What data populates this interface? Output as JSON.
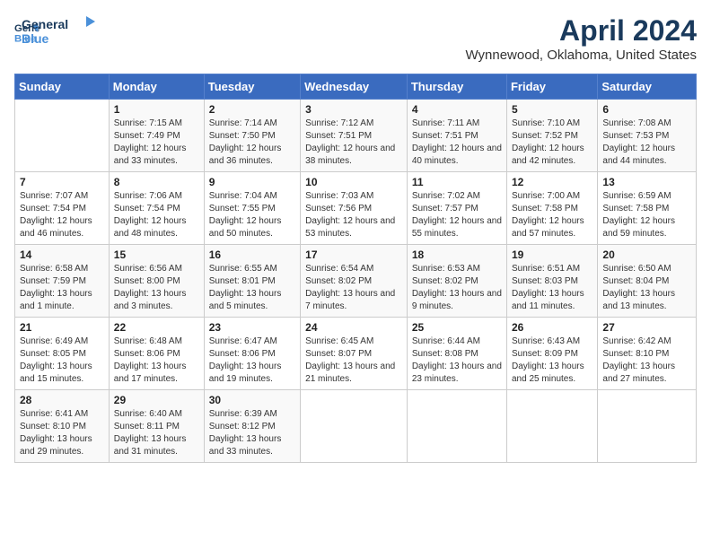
{
  "logo": {
    "line1": "General",
    "line2": "Blue"
  },
  "title": "April 2024",
  "subtitle": "Wynnewood, Oklahoma, United States",
  "days_of_week": [
    "Sunday",
    "Monday",
    "Tuesday",
    "Wednesday",
    "Thursday",
    "Friday",
    "Saturday"
  ],
  "weeks": [
    [
      {
        "day": "",
        "sunrise": "",
        "sunset": "",
        "daylight": ""
      },
      {
        "day": "1",
        "sunrise": "Sunrise: 7:15 AM",
        "sunset": "Sunset: 7:49 PM",
        "daylight": "Daylight: 12 hours and 33 minutes."
      },
      {
        "day": "2",
        "sunrise": "Sunrise: 7:14 AM",
        "sunset": "Sunset: 7:50 PM",
        "daylight": "Daylight: 12 hours and 36 minutes."
      },
      {
        "day": "3",
        "sunrise": "Sunrise: 7:12 AM",
        "sunset": "Sunset: 7:51 PM",
        "daylight": "Daylight: 12 hours and 38 minutes."
      },
      {
        "day": "4",
        "sunrise": "Sunrise: 7:11 AM",
        "sunset": "Sunset: 7:51 PM",
        "daylight": "Daylight: 12 hours and 40 minutes."
      },
      {
        "day": "5",
        "sunrise": "Sunrise: 7:10 AM",
        "sunset": "Sunset: 7:52 PM",
        "daylight": "Daylight: 12 hours and 42 minutes."
      },
      {
        "day": "6",
        "sunrise": "Sunrise: 7:08 AM",
        "sunset": "Sunset: 7:53 PM",
        "daylight": "Daylight: 12 hours and 44 minutes."
      }
    ],
    [
      {
        "day": "7",
        "sunrise": "Sunrise: 7:07 AM",
        "sunset": "Sunset: 7:54 PM",
        "daylight": "Daylight: 12 hours and 46 minutes."
      },
      {
        "day": "8",
        "sunrise": "Sunrise: 7:06 AM",
        "sunset": "Sunset: 7:54 PM",
        "daylight": "Daylight: 12 hours and 48 minutes."
      },
      {
        "day": "9",
        "sunrise": "Sunrise: 7:04 AM",
        "sunset": "Sunset: 7:55 PM",
        "daylight": "Daylight: 12 hours and 50 minutes."
      },
      {
        "day": "10",
        "sunrise": "Sunrise: 7:03 AM",
        "sunset": "Sunset: 7:56 PM",
        "daylight": "Daylight: 12 hours and 53 minutes."
      },
      {
        "day": "11",
        "sunrise": "Sunrise: 7:02 AM",
        "sunset": "Sunset: 7:57 PM",
        "daylight": "Daylight: 12 hours and 55 minutes."
      },
      {
        "day": "12",
        "sunrise": "Sunrise: 7:00 AM",
        "sunset": "Sunset: 7:58 PM",
        "daylight": "Daylight: 12 hours and 57 minutes."
      },
      {
        "day": "13",
        "sunrise": "Sunrise: 6:59 AM",
        "sunset": "Sunset: 7:58 PM",
        "daylight": "Daylight: 12 hours and 59 minutes."
      }
    ],
    [
      {
        "day": "14",
        "sunrise": "Sunrise: 6:58 AM",
        "sunset": "Sunset: 7:59 PM",
        "daylight": "Daylight: 13 hours and 1 minute."
      },
      {
        "day": "15",
        "sunrise": "Sunrise: 6:56 AM",
        "sunset": "Sunset: 8:00 PM",
        "daylight": "Daylight: 13 hours and 3 minutes."
      },
      {
        "day": "16",
        "sunrise": "Sunrise: 6:55 AM",
        "sunset": "Sunset: 8:01 PM",
        "daylight": "Daylight: 13 hours and 5 minutes."
      },
      {
        "day": "17",
        "sunrise": "Sunrise: 6:54 AM",
        "sunset": "Sunset: 8:02 PM",
        "daylight": "Daylight: 13 hours and 7 minutes."
      },
      {
        "day": "18",
        "sunrise": "Sunrise: 6:53 AM",
        "sunset": "Sunset: 8:02 PM",
        "daylight": "Daylight: 13 hours and 9 minutes."
      },
      {
        "day": "19",
        "sunrise": "Sunrise: 6:51 AM",
        "sunset": "Sunset: 8:03 PM",
        "daylight": "Daylight: 13 hours and 11 minutes."
      },
      {
        "day": "20",
        "sunrise": "Sunrise: 6:50 AM",
        "sunset": "Sunset: 8:04 PM",
        "daylight": "Daylight: 13 hours and 13 minutes."
      }
    ],
    [
      {
        "day": "21",
        "sunrise": "Sunrise: 6:49 AM",
        "sunset": "Sunset: 8:05 PM",
        "daylight": "Daylight: 13 hours and 15 minutes."
      },
      {
        "day": "22",
        "sunrise": "Sunrise: 6:48 AM",
        "sunset": "Sunset: 8:06 PM",
        "daylight": "Daylight: 13 hours and 17 minutes."
      },
      {
        "day": "23",
        "sunrise": "Sunrise: 6:47 AM",
        "sunset": "Sunset: 8:06 PM",
        "daylight": "Daylight: 13 hours and 19 minutes."
      },
      {
        "day": "24",
        "sunrise": "Sunrise: 6:45 AM",
        "sunset": "Sunset: 8:07 PM",
        "daylight": "Daylight: 13 hours and 21 minutes."
      },
      {
        "day": "25",
        "sunrise": "Sunrise: 6:44 AM",
        "sunset": "Sunset: 8:08 PM",
        "daylight": "Daylight: 13 hours and 23 minutes."
      },
      {
        "day": "26",
        "sunrise": "Sunrise: 6:43 AM",
        "sunset": "Sunset: 8:09 PM",
        "daylight": "Daylight: 13 hours and 25 minutes."
      },
      {
        "day": "27",
        "sunrise": "Sunrise: 6:42 AM",
        "sunset": "Sunset: 8:10 PM",
        "daylight": "Daylight: 13 hours and 27 minutes."
      }
    ],
    [
      {
        "day": "28",
        "sunrise": "Sunrise: 6:41 AM",
        "sunset": "Sunset: 8:10 PM",
        "daylight": "Daylight: 13 hours and 29 minutes."
      },
      {
        "day": "29",
        "sunrise": "Sunrise: 6:40 AM",
        "sunset": "Sunset: 8:11 PM",
        "daylight": "Daylight: 13 hours and 31 minutes."
      },
      {
        "day": "30",
        "sunrise": "Sunrise: 6:39 AM",
        "sunset": "Sunset: 8:12 PM",
        "daylight": "Daylight: 13 hours and 33 minutes."
      },
      {
        "day": "",
        "sunrise": "",
        "sunset": "",
        "daylight": ""
      },
      {
        "day": "",
        "sunrise": "",
        "sunset": "",
        "daylight": ""
      },
      {
        "day": "",
        "sunrise": "",
        "sunset": "",
        "daylight": ""
      },
      {
        "day": "",
        "sunrise": "",
        "sunset": "",
        "daylight": ""
      }
    ]
  ]
}
